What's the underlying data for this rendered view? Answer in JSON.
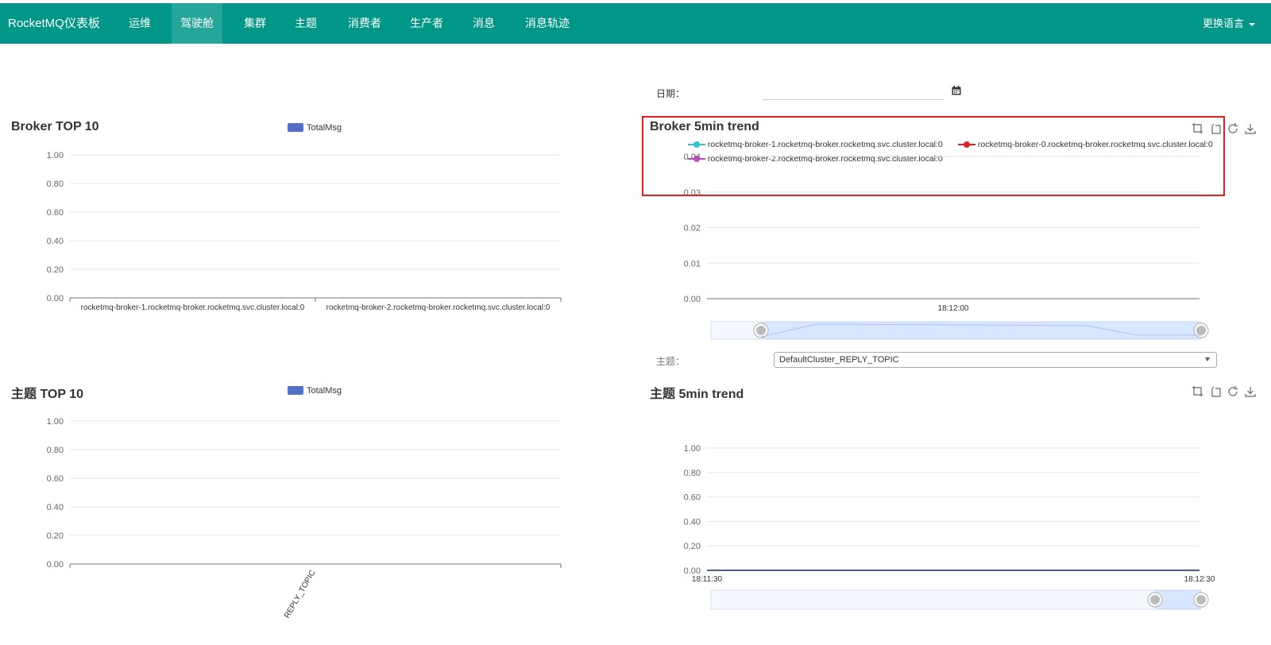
{
  "navbar": {
    "brand": "RocketMQ仪表板",
    "items": [
      {
        "label": "运维",
        "active": false
      },
      {
        "label": "驾驶舱",
        "active": true
      },
      {
        "label": "集群",
        "active": false
      },
      {
        "label": "主题",
        "active": false
      },
      {
        "label": "消费者",
        "active": false
      },
      {
        "label": "生产者",
        "active": false
      },
      {
        "label": "消息",
        "active": false
      },
      {
        "label": "消息轨迹",
        "active": false
      }
    ],
    "language": "更换语言"
  },
  "filters": {
    "date_label": "日期：",
    "date_value": "",
    "topic_label": "主题：",
    "topic_selected": "DefaultCluster_REPLY_TOPIC"
  },
  "colors": {
    "navbar": "#009688",
    "bar": "#5470c6",
    "series_broker1": "#2ec7c9",
    "series_broker0": "#e01f1f",
    "series_broker2": "#d83fd3",
    "highlight": "#e02020"
  },
  "toolbox_icons": [
    "zoom-icon",
    "zoom-reset-icon",
    "refresh-icon",
    "download-icon"
  ],
  "broker_top10": {
    "title": "Broker TOP 10",
    "legend": "TotalMsg",
    "chart_data": {
      "type": "bar",
      "categories": [
        "rocketmq-broker-1.rocketmq-broker.rocketmq.svc.cluster.local:0",
        "rocketmq-broker-2.rocketmq-broker.rocketmq.svc.cluster.local:0"
      ],
      "series": [
        {
          "name": "TotalMsg",
          "values": [
            0,
            0
          ]
        }
      ],
      "ylim": [
        0,
        1
      ],
      "yticks": [
        "0.00",
        "0.20",
        "0.40",
        "0.60",
        "0.80",
        "1.00"
      ]
    }
  },
  "broker_trend": {
    "title": "Broker 5min trend",
    "legend": [
      "rocketmq-broker-1.rocketmq-broker.rocketmq.svc.cluster.local:0",
      "rocketmq-broker-0.rocketmq-broker.rocketmq.svc.cluster.local:0",
      "rocketmq-broker-2.rocketmq-broker.rocketmq.svc.cluster.local:0"
    ],
    "chart_data": {
      "type": "line",
      "x": [
        "18:12:00"
      ],
      "ylim": [
        0,
        0.04
      ],
      "yticks": [
        "0.00",
        "0.01",
        "0.02",
        "0.03",
        "0.04"
      ]
    }
  },
  "topic_top10": {
    "title": "主题 TOP 10",
    "legend": "TotalMsg",
    "chart_data": {
      "type": "bar",
      "categories": [
        "REPLY_TOPIC"
      ],
      "series": [
        {
          "name": "TotalMsg",
          "values": [
            0
          ]
        }
      ],
      "ylim": [
        0,
        1
      ],
      "yticks": [
        "0.00",
        "0.20",
        "0.40",
        "0.60",
        "0.80",
        "1.00"
      ]
    }
  },
  "topic_trend": {
    "title": "主题 5min trend",
    "chart_data": {
      "type": "line",
      "x": [
        "18:11:30",
        "18:12:30"
      ],
      "ylim": [
        0,
        1
      ],
      "yticks": [
        "0.00",
        "0.20",
        "0.40",
        "0.60",
        "0.80",
        "1.00"
      ]
    }
  }
}
